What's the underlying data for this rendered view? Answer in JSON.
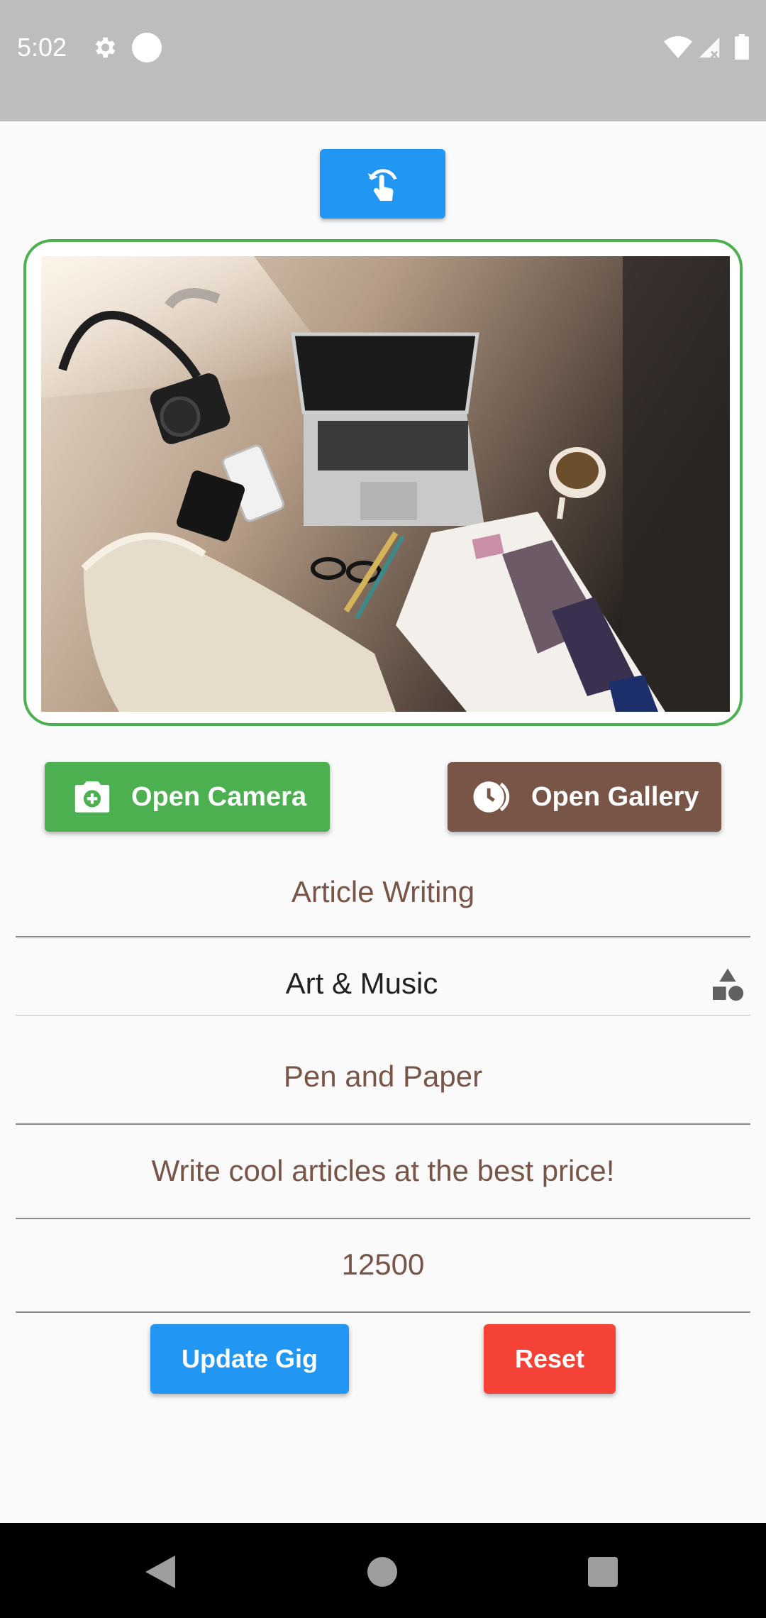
{
  "status_bar": {
    "time": "5:02",
    "icons": [
      "settings-icon",
      "notification-dot-icon",
      "wifi-icon",
      "cell-signal-icon",
      "battery-icon"
    ]
  },
  "toolbar": {
    "top_button_icon": "touch-rotate-icon",
    "accent_color": "#2196f3"
  },
  "image": {
    "description_icon": "photo-preview",
    "border_color": "#4caf50"
  },
  "buttons": {
    "open_camera": "Open Camera",
    "open_gallery": "Open Gallery",
    "camera_icon": "camera-plus-icon",
    "gallery_icon": "gallery-clock-icon",
    "camera_color": "#4caf50",
    "gallery_color": "#795548"
  },
  "form": {
    "title_value": "Article Writing",
    "category_selected": "Art & Music",
    "category_icon": "shapes-icon",
    "tools_value": "Pen and Paper",
    "description_value": "Write cool articles at the best price!",
    "price_value": "12500",
    "text_color": "#795548"
  },
  "actions": {
    "update": "Update Gig",
    "reset": "Reset",
    "update_color": "#2196f3",
    "reset_color": "#f44336"
  },
  "nav_bar": {
    "icons": [
      "back-icon",
      "home-icon",
      "recents-icon"
    ]
  }
}
